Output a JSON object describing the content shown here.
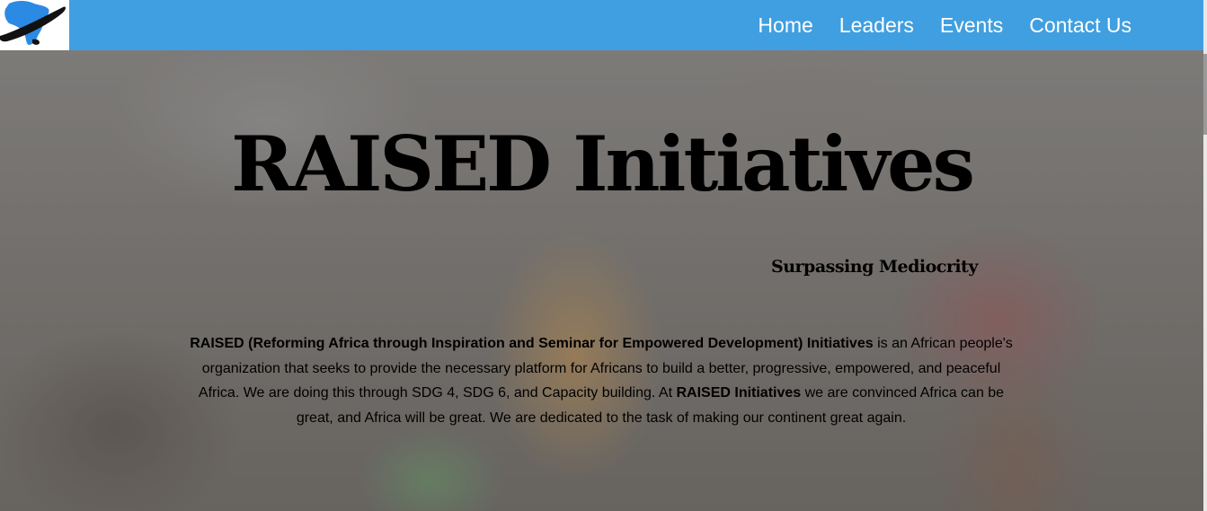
{
  "brand": {
    "logo_icon": "africa-globe-orbit-logo",
    "nav_color": "#409fe0",
    "logo_color": "#2b8ae3"
  },
  "nav": {
    "items": [
      {
        "label": "Home"
      },
      {
        "label": "Leaders"
      },
      {
        "label": "Events"
      },
      {
        "label": "Contact Us"
      }
    ]
  },
  "hero": {
    "title": "RAISED Initiatives",
    "subtitle": "Surpassing Mediocrity",
    "description": {
      "org_full_name": "RAISED (Reforming Africa through Inspiration and Seminar for Empowered Development) Initiatives",
      "text_1": " is an African people's organization that seeks to provide the necessary platform for Africans to build a better, progressive, empowered, and peaceful Africa. We are doing this through SDG 4, SDG 6, and Capacity building. At ",
      "org_short_name": "RAISED Initiatives",
      "text_2": " we are convinced Africa can be great, and Africa will be great. We are dedicated to the task of making our continent great again."
    }
  }
}
